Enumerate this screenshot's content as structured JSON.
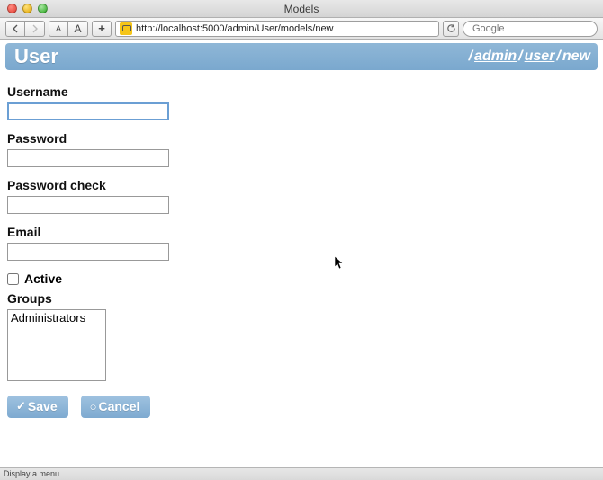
{
  "window": {
    "title": "Models"
  },
  "toolbar": {
    "url": "http://localhost:5000/admin/User/models/new",
    "search_placeholder": "Google",
    "font_smaller": "A",
    "font_larger": "A",
    "add": "+"
  },
  "header": {
    "title": "User",
    "breadcrumb": {
      "seg1": "admin",
      "seg2": "user",
      "seg3": "new"
    }
  },
  "form": {
    "username": {
      "label": "Username",
      "value": ""
    },
    "password": {
      "label": "Password",
      "value": ""
    },
    "password_check": {
      "label": "Password check",
      "value": ""
    },
    "email": {
      "label": "Email",
      "value": ""
    },
    "active": {
      "label": "Active",
      "checked": false
    },
    "groups": {
      "label": "Groups",
      "options": [
        "Administrators"
      ]
    },
    "buttons": {
      "save": "Save",
      "cancel": "Cancel"
    }
  },
  "statusbar": {
    "text": "Display a menu"
  }
}
